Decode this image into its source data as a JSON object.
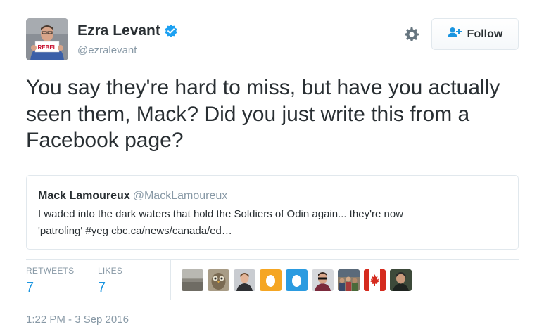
{
  "author": {
    "display_name": "Ezra Levant",
    "handle": "@ezralevant",
    "avatar_sign_text": "REBEL"
  },
  "follow_button": {
    "label": "Follow"
  },
  "tweet": {
    "text": "You say they're hard to miss, but have you actually seen them, Mack? Did you just write this from a Facebook page?"
  },
  "quoted_tweet": {
    "display_name": "Mack Lamoureux",
    "handle": "@MackLamoureux",
    "line1": "I waded into the dark waters that hold the Soldiers of Odin again... they're now",
    "line2": "'patroling' #yeg  cbc.ca/news/canada/ed…"
  },
  "stats": {
    "retweets_label": "RETWEETS",
    "retweets_count": "7",
    "likes_label": "LIKES",
    "likes_count": "7"
  },
  "likers": [
    {
      "icon": "landscape-photo-avatar"
    },
    {
      "icon": "owl-photo-avatar"
    },
    {
      "icon": "person-avatar"
    },
    {
      "icon": "egg-avatar-orange"
    },
    {
      "icon": "egg-avatar-blue"
    },
    {
      "icon": "person-sunglasses-avatar"
    },
    {
      "icon": "crowd-photo-avatar"
    },
    {
      "icon": "canada-flag-avatar"
    },
    {
      "icon": "person-dark-avatar"
    }
  ],
  "timestamp": "1:22 PM - 3 Sep 2016",
  "colors": {
    "accent": "#1b95e0",
    "text": "#292f33",
    "muted": "#8899a6",
    "border": "#e1e8ed",
    "verified": "#1da1f2"
  }
}
